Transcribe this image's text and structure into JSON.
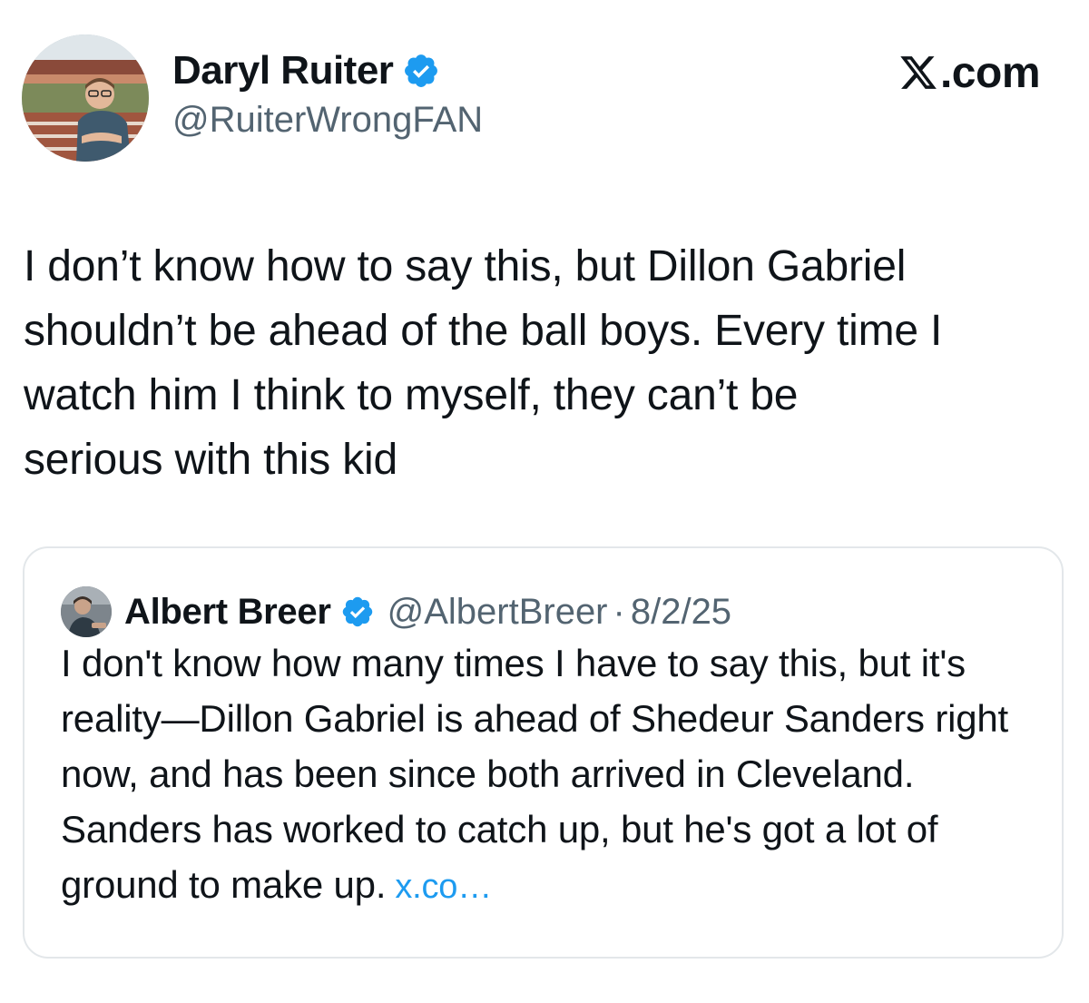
{
  "author": {
    "name": "Daryl Ruiter",
    "handle": "@RuiterWrongFAN",
    "avatar_icon": "profile-photo",
    "verified_icon": "verified-badge-icon",
    "verified_color": "#1d9bf0"
  },
  "brand": {
    "label": ".com",
    "icon": "x-logo-icon"
  },
  "tweet": {
    "text": "I don’t know how to say this, but Dillon Gabriel\nshouldn’t be ahead of the ball boys. Every time I\nwatch him I think to myself, they can’t be\nserious with this kid"
  },
  "quote": {
    "name": "Albert Breer",
    "handle": "@AlbertBreer",
    "separator": "·",
    "date": "8/2/25",
    "text": "I don't know how many times I have to say this, but it's reality—Dillon Gabriel is ahead of Shedeur Sanders right now, and has been since both arrived in Cleveland. Sanders has worked to catch up, but he's got a lot of ground to make up.",
    "link": "x.co…",
    "link_color": "#1d9bf0"
  },
  "colors": {
    "text": "#0f1419",
    "secondary": "#536471",
    "border": "#e3e7ea"
  }
}
